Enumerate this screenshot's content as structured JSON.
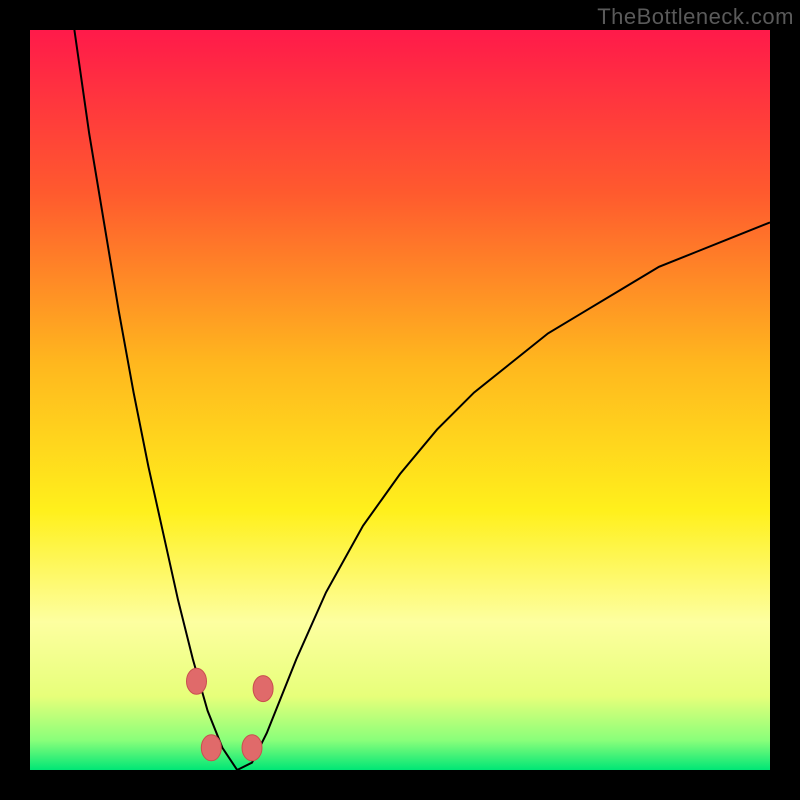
{
  "watermark": {
    "text": "TheBottleneck.com"
  },
  "colors": {
    "frame": "#000000",
    "watermark": "#5a5a5a",
    "gradient_stops": [
      {
        "offset": "0%",
        "color": "#ff1a4a"
      },
      {
        "offset": "22%",
        "color": "#ff5a2e"
      },
      {
        "offset": "45%",
        "color": "#ffb71e"
      },
      {
        "offset": "65%",
        "color": "#fff01c"
      },
      {
        "offset": "80%",
        "color": "#fdffa0"
      },
      {
        "offset": "90%",
        "color": "#e7ff7a"
      },
      {
        "offset": "96%",
        "color": "#89ff7a"
      },
      {
        "offset": "100%",
        "color": "#00e676"
      }
    ],
    "curve": "#000000",
    "marker_fill": "#e06a6a",
    "marker_stroke": "#c94f4f"
  },
  "chart_data": {
    "type": "line",
    "title": "",
    "xlabel": "",
    "ylabel": "",
    "xlim": [
      0,
      100
    ],
    "ylim": [
      0,
      100
    ],
    "curve_notes": "V-shaped bottleneck curve: approaches 100 at x≈6, drops to 0 around x≈24–30, then asymptotically rises toward ~70+ as x→100. Values estimated from pixel positions (no axis ticks visible).",
    "series": [
      {
        "name": "bottleneck-curve",
        "x": [
          6,
          8,
          10,
          12,
          14,
          16,
          18,
          20,
          22,
          24,
          26,
          28,
          30,
          32,
          34,
          36,
          40,
          45,
          50,
          55,
          60,
          65,
          70,
          75,
          80,
          85,
          90,
          95,
          100
        ],
        "y": [
          100,
          86,
          74,
          62,
          51,
          41,
          32,
          23,
          15,
          8,
          3,
          0,
          1,
          5,
          10,
          15,
          24,
          33,
          40,
          46,
          51,
          55,
          59,
          62,
          65,
          68,
          70,
          72,
          74
        ]
      }
    ],
    "markers": {
      "name": "highlighted-points",
      "points": [
        {
          "x": 22.5,
          "y": 12
        },
        {
          "x": 31.5,
          "y": 11
        },
        {
          "x": 24.5,
          "y": 3
        },
        {
          "x": 30.0,
          "y": 3
        }
      ]
    }
  }
}
